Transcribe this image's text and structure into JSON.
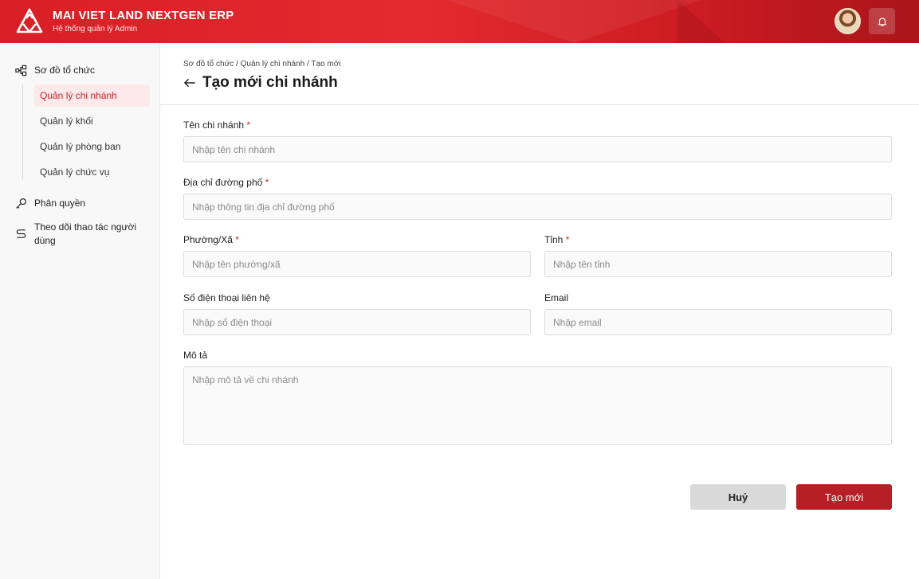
{
  "header": {
    "title": "MAI VIET LAND NEXTGEN ERP",
    "subtitle": "Hệ thống quản lý Admin",
    "icons": {
      "logo": "triangle-logo",
      "avatar": "user-avatar",
      "bell": "bell-icon"
    }
  },
  "sidebar": {
    "org_chart": "Sơ đồ tổ chức",
    "sub_items": [
      "Quản lý chi nhánh",
      "Quản lý khối",
      "Quản lý phòng ban",
      "Quản lý chức vụ"
    ],
    "permissions": "Phân quyền",
    "activity_tracking": "Theo dõi thao tác người dùng"
  },
  "page": {
    "breadcrumb": "Sơ đồ tổ chức / Quản lý chi nhánh / Tạo mới",
    "title": "Tạo mới chi nhánh"
  },
  "form": {
    "branch_name": {
      "label": "Tên chi nhánh",
      "required": "*",
      "placeholder": "Nhập tên chi nhánh"
    },
    "street_address": {
      "label": "Địa chỉ đường phố",
      "required": "*",
      "placeholder": "Nhập thông tin địa chỉ đường phố"
    },
    "ward": {
      "label": "Phường/Xã",
      "required": "*",
      "placeholder": "Nhập tên phường/xã"
    },
    "province": {
      "label": "Tỉnh",
      "required": "*",
      "placeholder": "Nhập tên tỉnh"
    },
    "phone": {
      "label": "Số điện thoại liên hệ",
      "placeholder": "Nhập số điện thoại"
    },
    "email": {
      "label": "Email",
      "placeholder": "Nhập email"
    },
    "description": {
      "label": "Mô tả",
      "placeholder": "Nhập mô tả về chi nhánh"
    }
  },
  "actions": {
    "cancel": "Huỷ",
    "create": "Tạo mới"
  },
  "colors": {
    "brand_red": "#d81f26",
    "primary_button": "#b71f26",
    "active_bg": "#fde9e9",
    "active_text": "#c8232b"
  }
}
